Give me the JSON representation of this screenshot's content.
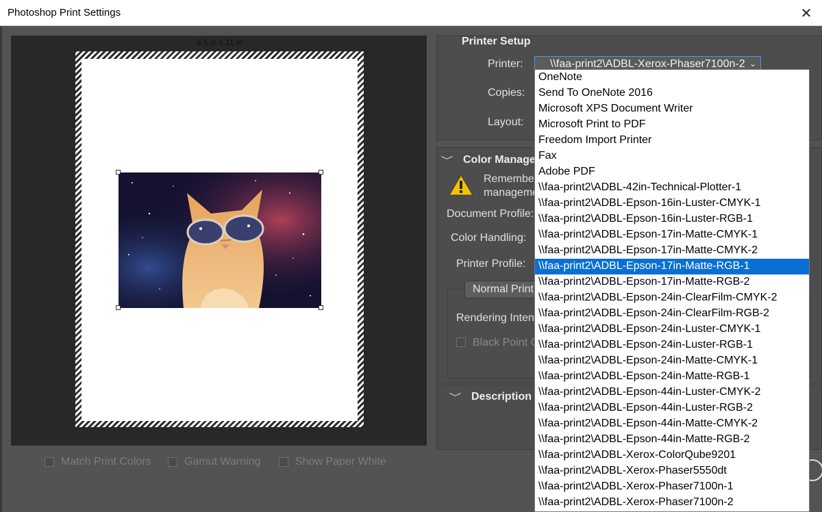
{
  "window": {
    "title": "Photoshop Print Settings",
    "close_glyph": "✕"
  },
  "preview": {
    "paper_size": "8.5 in x 11 in"
  },
  "bottom_options": {
    "match_print_colors": "Match Print Colors",
    "gamut_warning": "Gamut Warning",
    "show_paper_white": "Show Paper White"
  },
  "printer_setup": {
    "title": "Printer Setup",
    "printer_label": "Printer:",
    "printer_value": "\\\\faa-print2\\ADBL-Xerox-Phaser7100n-2",
    "copies_label": "Copies:",
    "layout_label": "Layout:"
  },
  "color_management": {
    "title": "Color Manage",
    "warning_line1": "Remember",
    "warning_line2": "manageme",
    "document_profile_label": "Document Profile:",
    "color_handling_label": "Color Handling:",
    "printer_profile_label": "Printer Profile:",
    "normal_printing": "Normal Print",
    "rendering_intent_label": "Rendering Inten",
    "black_point_label": "Black Point C"
  },
  "description": {
    "title": "Description"
  },
  "printer_dropdown": {
    "selected_index": 12,
    "options": [
      "OneNote",
      "Send To OneNote 2016",
      "Microsoft XPS Document Writer",
      "Microsoft Print to PDF",
      "Freedom Import Printer",
      "Fax",
      "Adobe PDF",
      "\\\\faa-print2\\ADBL-42in-Technical-Plotter-1",
      "\\\\faa-print2\\ADBL-Epson-16in-Luster-CMYK-1",
      "\\\\faa-print2\\ADBL-Epson-16in-Luster-RGB-1",
      "\\\\faa-print2\\ADBL-Epson-17in-Matte-CMYK-1",
      "\\\\faa-print2\\ADBL-Epson-17in-Matte-CMYK-2",
      "\\\\faa-print2\\ADBL-Epson-17in-Matte-RGB-1",
      "\\\\faa-print2\\ADBL-Epson-17in-Matte-RGB-2",
      "\\\\faa-print2\\ADBL-Epson-24in-ClearFilm-CMYK-2",
      "\\\\faa-print2\\ADBL-Epson-24in-ClearFilm-RGB-2",
      "\\\\faa-print2\\ADBL-Epson-24in-Luster-CMYK-1",
      "\\\\faa-print2\\ADBL-Epson-24in-Luster-RGB-1",
      "\\\\faa-print2\\ADBL-Epson-24in-Matte-CMYK-1",
      "\\\\faa-print2\\ADBL-Epson-24in-Matte-RGB-1",
      "\\\\faa-print2\\ADBL-Epson-44in-Luster-CMYK-2",
      "\\\\faa-print2\\ADBL-Epson-44in-Luster-RGB-2",
      "\\\\faa-print2\\ADBL-Epson-44in-Matte-CMYK-2",
      "\\\\faa-print2\\ADBL-Epson-44in-Matte-RGB-2",
      "\\\\faa-print2\\ADBL-Xerox-ColorQube9201",
      "\\\\faa-print2\\ADBL-Xerox-Phaser5550dt",
      "\\\\faa-print2\\ADBL-Xerox-Phaser7100n-1",
      "\\\\faa-print2\\ADBL-Xerox-Phaser7100n-2"
    ]
  },
  "colors": {
    "accent": "#0a6fd5",
    "dialog_bg": "#535353",
    "preview_bg": "#282828"
  }
}
